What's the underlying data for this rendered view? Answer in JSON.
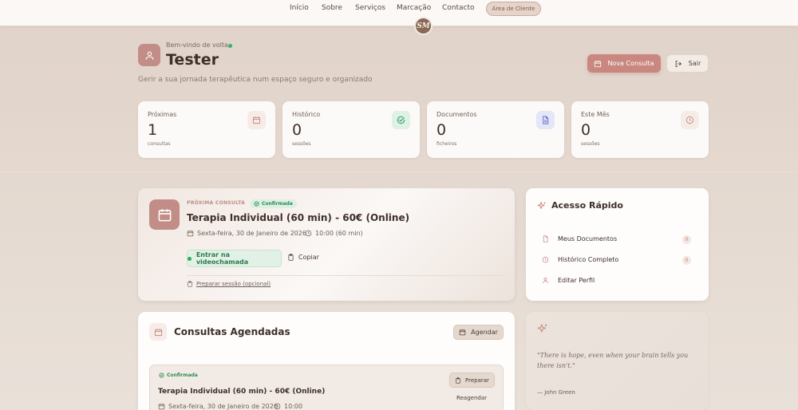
{
  "nav": {
    "links": [
      "Início",
      "Sobre",
      "Serviços",
      "Marcação",
      "Contacto"
    ],
    "client_area": "Área de Cliente",
    "logo_text": "SM"
  },
  "header": {
    "welcome": "Bem-vindo de volta,",
    "user_name": "Tester",
    "subtitle": "Gerir a sua jornada terapêutica num espaço seguro e organizado",
    "new_button": "Nova Consulta",
    "logout_button": "Sair"
  },
  "stats": [
    {
      "label": "Próximas",
      "value": "1",
      "unit": "consultas",
      "icon": "calendar-icon"
    },
    {
      "label": "Histórico",
      "value": "0",
      "unit": "sessões",
      "icon": "check-circle-icon"
    },
    {
      "label": "Documentos",
      "value": "0",
      "unit": "ficheiros",
      "icon": "document-icon"
    },
    {
      "label": "Este Mês",
      "value": "0",
      "unit": "sessões",
      "icon": "clock-icon"
    }
  ],
  "next": {
    "label": "PRÓXIMA CONSULTA",
    "status": "Confirmada",
    "title": "Terapia Individual (60 min) - 60€ (Online)",
    "date": "Sexta-feira, 30 de Janeiro de 2026",
    "time": "10:00 (60 min)",
    "video_button": "Entrar na videochamada",
    "copy_button": "Copiar",
    "prepare_link": "Preparar sessão (opcional)"
  },
  "quick": {
    "title": "Acesso Rápido",
    "items": [
      {
        "label": "Meus Documentos",
        "count": "0"
      },
      {
        "label": "Histórico Completo",
        "count": "0"
      },
      {
        "label": "Editar Perfil"
      }
    ]
  },
  "scheduled": {
    "title": "Consultas Agendadas",
    "button": "Agendar",
    "item": {
      "status": "Confirmada",
      "title": "Terapia Individual (60 min) - 60€ (Online)",
      "date": "Sexta-feira, 30 de Janeiro de 2026",
      "time": "10:00",
      "prepare_button": "Preparar",
      "reschedule": "Reagendar"
    }
  },
  "quote": {
    "text": "\"There is hope, even when your brain tells you there isn't.\"",
    "author": "— John Green"
  },
  "colors": {
    "accent": "#c9877f",
    "success": "#2e8b57",
    "background": "#e2d5cc"
  }
}
